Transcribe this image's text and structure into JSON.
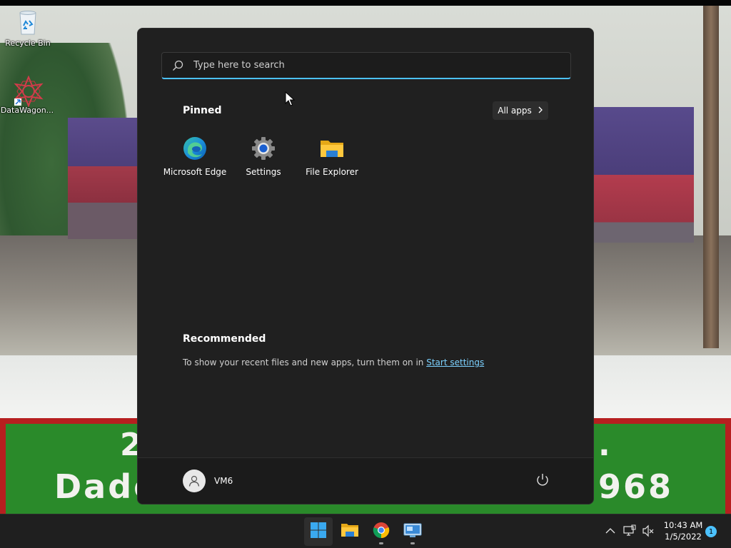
{
  "desktop": {
    "icons": [
      {
        "label": "Recycle Bin",
        "icon": "recycle-bin-icon"
      },
      {
        "label": "DataWagon...",
        "icon": "datawagon-icon"
      }
    ],
    "wallpaper_banner": {
      "line1": "2",
      "line1_right": ".",
      "line2_left": "Dade",
      "line2_right": "968"
    }
  },
  "start_menu": {
    "search": {
      "placeholder": "Type here to search",
      "value": ""
    },
    "pinned": {
      "title": "Pinned",
      "all_apps_label": "All apps",
      "apps": [
        {
          "label": "Microsoft Edge",
          "icon": "edge-icon"
        },
        {
          "label": "Settings",
          "icon": "settings-gear-icon"
        },
        {
          "label": "File Explorer",
          "icon": "folder-icon"
        }
      ]
    },
    "recommended": {
      "title": "Recommended",
      "message": "To show your recent files and new apps, turn them on in ",
      "link_label": "Start settings"
    },
    "footer": {
      "user_name": "VM6",
      "power_icon": "power-icon"
    }
  },
  "taskbar": {
    "apps": [
      {
        "name": "Start",
        "icon": "windows-start-icon",
        "active": true
      },
      {
        "name": "File Explorer",
        "icon": "folder-icon",
        "active": false
      },
      {
        "name": "Google Chrome",
        "icon": "chrome-icon",
        "active": false,
        "running": true
      },
      {
        "name": "Remote Desktop",
        "icon": "remote-desktop-icon",
        "active": false,
        "running": true
      }
    ],
    "tray": {
      "icons": [
        "chevron-up-icon",
        "network-icon",
        "volume-muted-icon"
      ],
      "time": "10:43 AM",
      "date": "1/5/2022",
      "notification_count": "1"
    }
  },
  "colors": {
    "accent": "#4cc2ff",
    "menu_bg": "#202020",
    "taskbar_bg": "#1f1f1f"
  }
}
